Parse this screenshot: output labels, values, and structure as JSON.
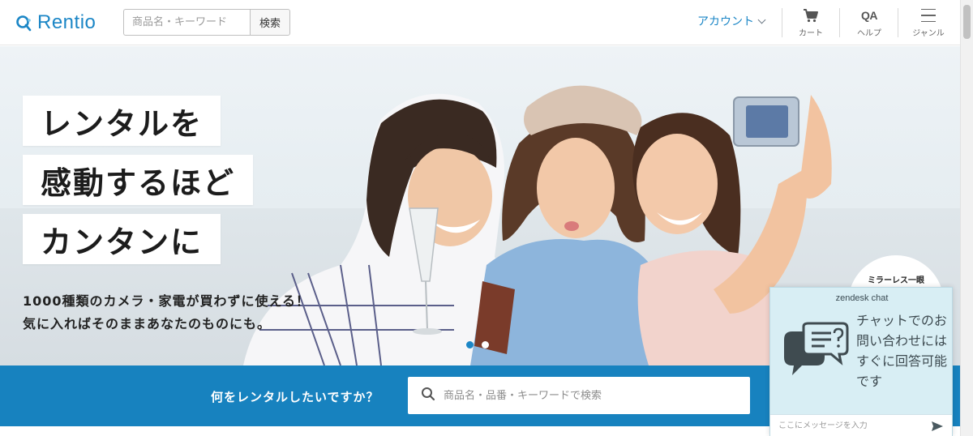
{
  "header": {
    "logo_text": "Rentio",
    "search_placeholder": "商品名・キーワード",
    "search_button": "検索",
    "account_label": "アカウント",
    "cart_label": "カート",
    "help_icon_text": "QA",
    "help_label": "ヘルプ",
    "genre_label": "ジャンル"
  },
  "hero": {
    "headline_lines": [
      "レンタルを",
      "感動するほど",
      "カンタンに"
    ],
    "subtext_lines": [
      "1000種類のカメラ・家電が買わずに使える！",
      "気に入ればそのままあなたのものにも。"
    ],
    "badge_text": "ミラーレス一眼",
    "slide_count": 2,
    "active_slide": 1
  },
  "search_band": {
    "label": "何をレンタルしたいですか？",
    "placeholder": "商品名・品番・キーワードで検索"
  },
  "chat": {
    "brand": "zendesk chat",
    "message": "チャットでのお問い合わせにはすぐに回答可能です",
    "input_placeholder": "ここにメッセージを入力"
  },
  "colors": {
    "brand_blue": "#1b86c6",
    "band_blue": "#1782bf",
    "chat_bg": "#d8eef4"
  }
}
